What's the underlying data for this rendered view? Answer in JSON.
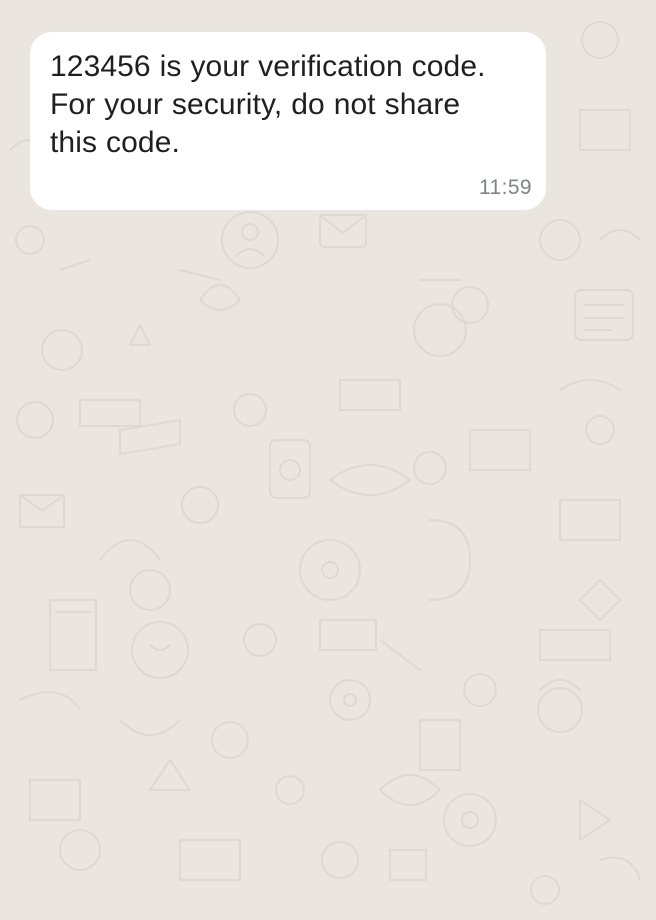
{
  "chat": {
    "message": {
      "lines": [
        "123456 is your verification code.",
        "For your security, do not share",
        "this code."
      ],
      "time": "11:59"
    },
    "wallpaper": {
      "background_color": "#eae6df",
      "doodle_color": "#dcd7cf",
      "icons": [
        "doodle-pattern-icon"
      ]
    },
    "bubble_color": "#ffffff"
  }
}
